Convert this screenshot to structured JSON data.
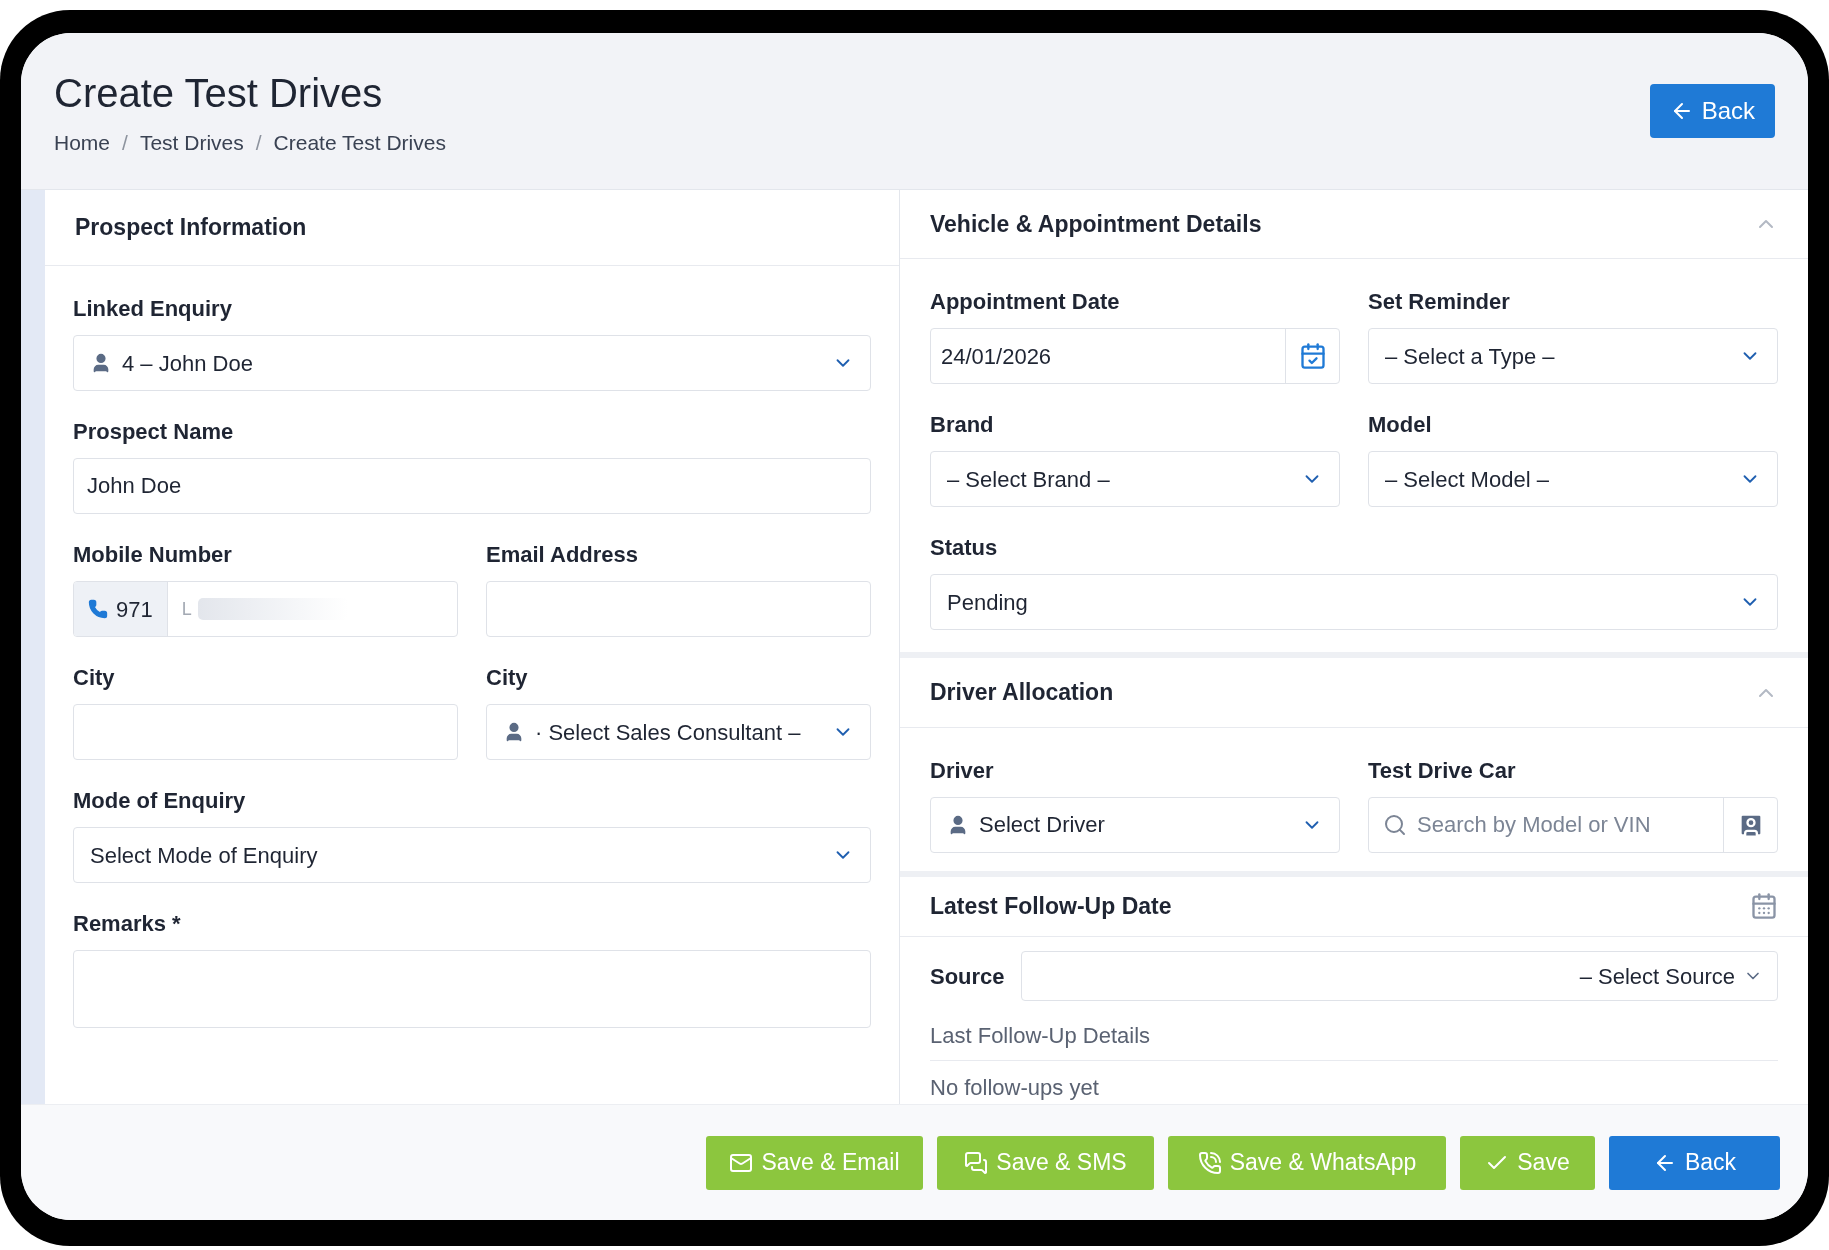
{
  "header": {
    "title": "Create Test Drives",
    "breadcrumb": [
      "Home",
      "Test Drives",
      "Create Test Drives"
    ],
    "separator": "/",
    "back": "Back"
  },
  "prospect": {
    "title": "Prospect Information",
    "rows": [
      [
        {
          "label": "Linked Enquiry",
          "kind": "user-select",
          "value": "4 – John Doe"
        }
      ],
      [
        {
          "label": "Prospect Name",
          "kind": "text",
          "value": "John Doe"
        }
      ],
      [
        {
          "label": "Mobile Number",
          "kind": "phone",
          "prefix": "971",
          "placeholder": "L"
        },
        {
          "label": "Email Address",
          "kind": "text"
        }
      ],
      [
        {
          "label": "City",
          "kind": "text"
        },
        {
          "label": "City",
          "kind": "user-select",
          "value": "· Select Sales Consultant –"
        }
      ],
      [
        {
          "label": "Mode of Enquiry",
          "kind": "select",
          "value": "Select Mode of Enquiry"
        }
      ],
      [
        {
          "label": "Remarks *",
          "kind": "textarea"
        }
      ]
    ]
  },
  "vehicle": {
    "title": "Vehicle & Appointment Details",
    "rows": [
      [
        {
          "label": "Appointment Date",
          "kind": "date",
          "value": "24/01/2026"
        },
        {
          "label": "Set Reminder",
          "kind": "select",
          "value": "– Select a Type –"
        }
      ],
      [
        {
          "label": "Brand",
          "kind": "select",
          "value": "– Select Brand –"
        },
        {
          "label": "Model",
          "kind": "select",
          "value": "– Select Model –"
        }
      ],
      [
        {
          "label": "Status",
          "kind": "select",
          "value": "Pending"
        }
      ]
    ]
  },
  "driver": {
    "title": "Driver Allocation",
    "rows": [
      [
        {
          "label": "Driver",
          "kind": "user-select",
          "value": "Select Driver"
        },
        {
          "label": "Test Drive Car",
          "kind": "search",
          "placeholder": "Search by Model or VIN"
        }
      ]
    ]
  },
  "followup": {
    "title": "Latest Follow-Up Date",
    "source_label": "Source",
    "source_value": "– Select Source",
    "details_label": "Last Follow-Up Details",
    "empty": "No follow-ups yet"
  },
  "actions": [
    {
      "label": "Save & Email",
      "kind": "email"
    },
    {
      "label": "Save & SMS",
      "kind": "sms"
    },
    {
      "label": "Save & WhatsApp",
      "kind": "whatsapp"
    },
    {
      "label": "Save",
      "kind": "save"
    },
    {
      "label": "Back",
      "kind": "back"
    }
  ]
}
